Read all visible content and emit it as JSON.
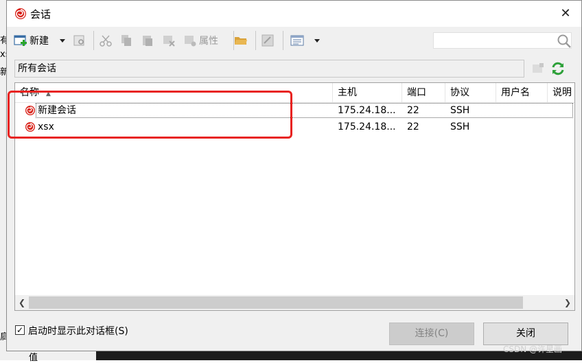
{
  "background": {
    "left_fragments": [
      "有",
      "xs",
      "新",
      "扃",
      "值"
    ]
  },
  "dialog": {
    "title": "会话",
    "close_glyph": "✕",
    "icon": "snail-icon"
  },
  "toolbar": {
    "new_label": "新建",
    "properties_label": "属性"
  },
  "search": {
    "placeholder": ""
  },
  "pathbar": {
    "text": "所有会话"
  },
  "list": {
    "columns": [
      "名称",
      "主机",
      "端口",
      "协议",
      "用户名",
      "说明"
    ],
    "rows": [
      {
        "name": "新建会话",
        "host": "175.24.18...",
        "port": "22",
        "protocol": "SSH",
        "user": "",
        "desc": ""
      },
      {
        "name": "xsx",
        "host": "175.24.18...",
        "port": "22",
        "protocol": "SSH",
        "user": "",
        "desc": ""
      }
    ]
  },
  "footer": {
    "show_on_startup": "启动时显示此对话框(S)",
    "checked": true,
    "connect_label": "连接(C)",
    "close_label": "关闭"
  },
  "watermark": "CSDN @许星画",
  "colors": {
    "highlight": "#e8231f",
    "accent_snail": "#d9241b"
  }
}
